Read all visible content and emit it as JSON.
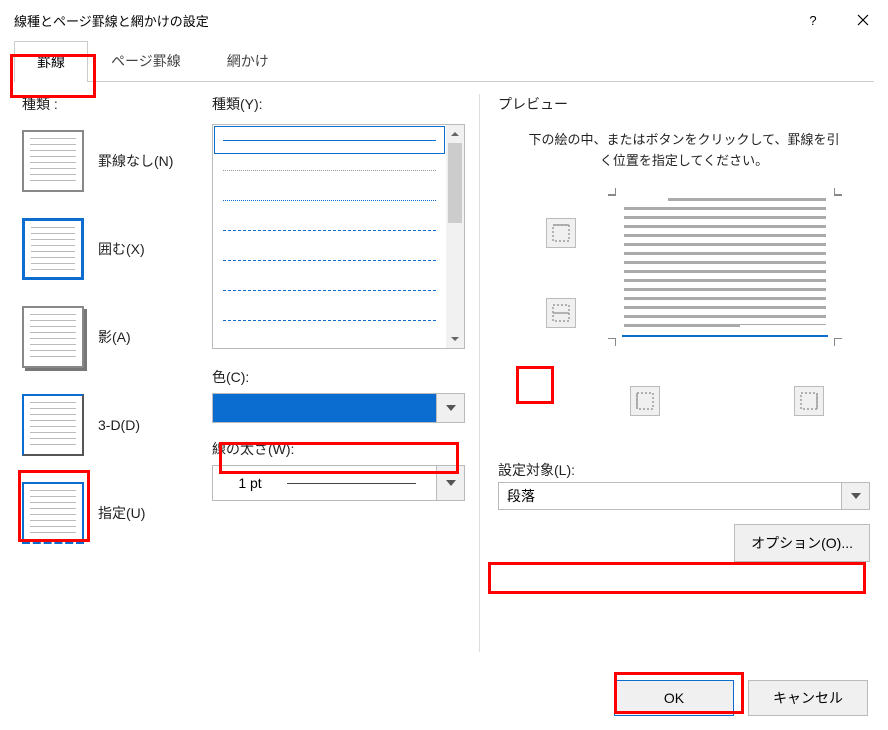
{
  "title": "線種とページ罫線と網かけの設定",
  "titlebar": {
    "help": "?",
    "close": "×"
  },
  "tabs": {
    "border": "罫線",
    "pageBorder": "ページ罫線",
    "shading": "網かけ"
  },
  "activeTab": "border",
  "col1": {
    "label": "種類 :",
    "presets": {
      "none": "罫線なし(N)",
      "box": "囲む(X)",
      "shadow": "影(A)",
      "threeD": "3-D(D)",
      "custom": "指定(U)"
    },
    "selected": "custom"
  },
  "col2": {
    "styleLabel": "種類(Y):",
    "colorLabel": "色(C):",
    "colorValue": "#0b6dcf",
    "widthLabel": "線の太さ(W):",
    "widthValue": "1 pt"
  },
  "col3": {
    "label": "プレビュー",
    "hint": "下の絵の中、またはボタンをクリックして、罫線を引く位置を指定してください。",
    "applyLabel": "設定対象(L):",
    "applyValue": "段落",
    "optionsBtn": "オプション(O)..."
  },
  "buttons": {
    "ok": "OK",
    "cancel": "キャンセル"
  }
}
